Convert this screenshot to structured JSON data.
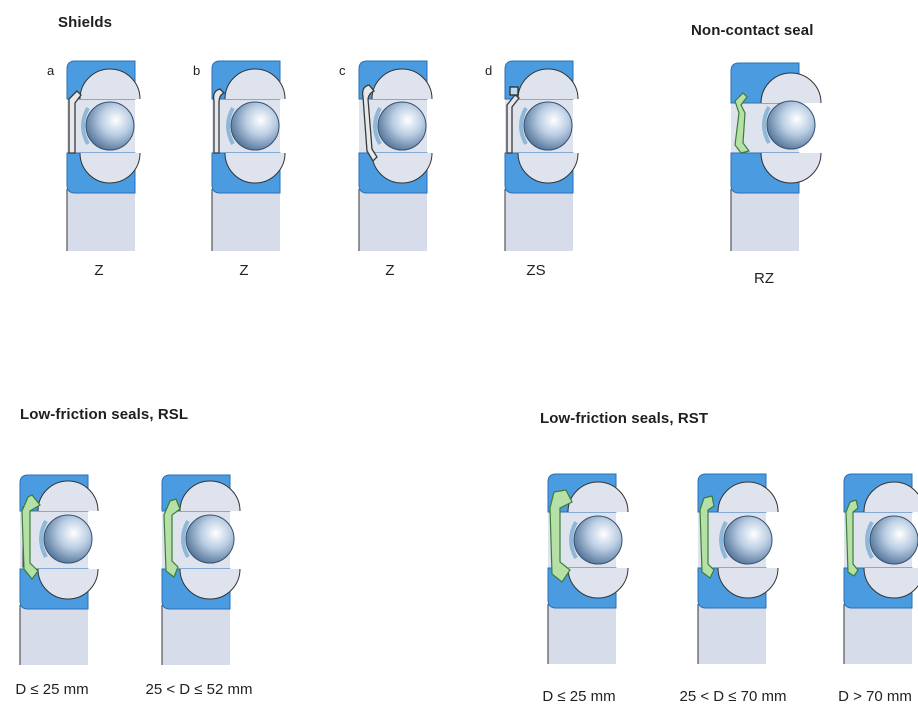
{
  "colors": {
    "ring": "#4a9be0",
    "ring_edge": "#2a6fb6",
    "bore": "#d7dcea",
    "gap": "#dfe3ee",
    "shield_fill": "#e6e8ec",
    "shield_stroke": "#3a3a3a",
    "seal_green": "#b7e0a6",
    "seal_green_stroke": "#3a7d3a",
    "ball_light": "#ffffff",
    "ball_mid": "#b9cde3",
    "ball_dark": "#4a6c93"
  },
  "sections": {
    "shields": "Shields",
    "non_contact": "Non-contact seal",
    "rsl": "Low-friction seals, RSL",
    "rst": "Low-friction seals, RST"
  },
  "figures": [
    {
      "id": "a",
      "letter": "a",
      "caption": "Z",
      "kind": "shield"
    },
    {
      "id": "b",
      "letter": "b",
      "caption": "Z",
      "kind": "shield"
    },
    {
      "id": "c",
      "letter": "c",
      "caption": "Z",
      "kind": "shield"
    },
    {
      "id": "d",
      "letter": "d",
      "caption": "ZS",
      "kind": "shield"
    },
    {
      "id": "rz",
      "letter": "",
      "caption": "RZ",
      "kind": "seal"
    },
    {
      "id": "rsl1",
      "letter": "",
      "caption": "D ≤ 25 mm",
      "kind": "seal"
    },
    {
      "id": "rsl2",
      "letter": "",
      "caption": "25 < D ≤ 52 mm",
      "kind": "seal"
    },
    {
      "id": "rst1",
      "letter": "",
      "caption": "D ≤ 25 mm",
      "kind": "seal"
    },
    {
      "id": "rst2",
      "letter": "",
      "caption": "25 < D ≤ 70 mm",
      "kind": "seal"
    },
    {
      "id": "rst3",
      "letter": "",
      "caption": "D > 70 mm",
      "kind": "seal"
    }
  ]
}
